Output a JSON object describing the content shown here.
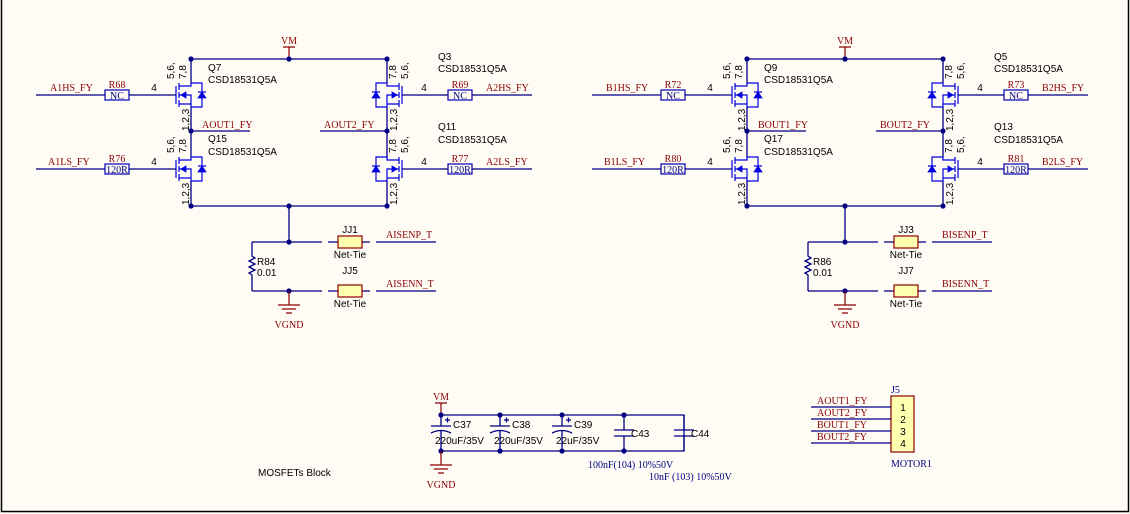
{
  "power": {
    "vm": "VM",
    "vgnd": "VGND"
  },
  "bridges": [
    {
      "fets": [
        {
          "ref": "Q7",
          "part": "CSD18531Q5A",
          "pins_a": "5,6,",
          "pins_b": "7,8",
          "pins_src": "1,2,3",
          "gate_pin": "4",
          "resistor": {
            "ref": "R68",
            "value": "NC"
          },
          "net": "A1HS_FY"
        },
        {
          "ref": "Q15",
          "part": "CSD18531Q5A",
          "pins_a": "5,6,",
          "pins_b": "7,8",
          "pins_src": "1,2,3",
          "gate_pin": "4",
          "resistor": {
            "ref": "R76",
            "value": "120R"
          },
          "net": "A1LS_FY"
        },
        {
          "ref": "Q3",
          "part": "CSD18531Q5A",
          "pins_a": "5,6,",
          "pins_b": "7,8",
          "pins_src": "1,2,3",
          "gate_pin": "4",
          "resistor": {
            "ref": "R69",
            "value": "NC"
          },
          "net": "A2HS_FY"
        },
        {
          "ref": "Q11",
          "part": "CSD18531Q5A",
          "pins_a": "5,6,",
          "pins_b": "7,8",
          "pins_src": "1,2,3",
          "gate_pin": "4",
          "resistor": {
            "ref": "R77",
            "value": "120R"
          },
          "net": "A2LS_FY"
        }
      ],
      "outputs": [
        "AOUT1_FY",
        "AOUT2_FY"
      ],
      "shunt": {
        "ref": "R84",
        "value": "0.01"
      },
      "ties": [
        {
          "ref": "JJ1",
          "value": "Net-Tie",
          "net": "AISENP_T"
        },
        {
          "ref": "JJ5",
          "value": "Net-Tie",
          "net": "AISENN_T"
        }
      ]
    },
    {
      "fets": [
        {
          "ref": "Q9",
          "part": "CSD18531Q5A",
          "pins_a": "5,6,",
          "pins_b": "7,8",
          "pins_src": "1,2,3",
          "gate_pin": "4",
          "resistor": {
            "ref": "R72",
            "value": "NC"
          },
          "net": "B1HS_FY"
        },
        {
          "ref": "Q17",
          "part": "CSD18531Q5A",
          "pins_a": "5,6,",
          "pins_b": "7,8",
          "pins_src": "1,2,3",
          "gate_pin": "4",
          "resistor": {
            "ref": "R80",
            "value": "120R"
          },
          "net": "B1LS_FY"
        },
        {
          "ref": "Q5",
          "part": "CSD18531Q5A",
          "pins_a": "5,6,",
          "pins_b": "7,8",
          "pins_src": "1,2,3",
          "gate_pin": "4",
          "resistor": {
            "ref": "R73",
            "value": "NC"
          },
          "net": "B2HS_FY"
        },
        {
          "ref": "Q13",
          "part": "CSD18531Q5A",
          "pins_a": "5,6,",
          "pins_b": "7,8",
          "pins_src": "1,2,3",
          "gate_pin": "4",
          "resistor": {
            "ref": "R81",
            "value": "120R"
          },
          "net": "B2LS_FY"
        }
      ],
      "outputs": [
        "BOUT1_FY",
        "BOUT2_FY"
      ],
      "shunt": {
        "ref": "R86",
        "value": "0.01"
      },
      "ties": [
        {
          "ref": "JJ3",
          "value": "Net-Tie",
          "net": "BISENP_T"
        },
        {
          "ref": "JJ7",
          "value": "Net-Tie",
          "net": "BISENN_T"
        }
      ]
    }
  ],
  "capacitors": [
    {
      "ref": "C37",
      "value": "220uF/35V",
      "polarized": true
    },
    {
      "ref": "C38",
      "value": "220uF/35V",
      "polarized": true
    },
    {
      "ref": "C39",
      "value": "22uF/35V",
      "polarized": true
    },
    {
      "ref": "C43",
      "value": "",
      "polarized": false
    },
    {
      "ref": "C44",
      "value": "",
      "polarized": false
    }
  ],
  "cap_notes": [
    "100nF(104) 10%50V",
    "10nF (103) 10%50V"
  ],
  "connector": {
    "ref": "J5",
    "name": "MOTOR1",
    "pins": [
      {
        "num": "1",
        "net": "AOUT1_FY"
      },
      {
        "num": "2",
        "net": "AOUT2_FY"
      },
      {
        "num": "3",
        "net": "BOUT1_FY"
      },
      {
        "num": "4",
        "net": "BOUT2_FY"
      }
    ]
  },
  "sheet_title": "MOSFETs Block"
}
